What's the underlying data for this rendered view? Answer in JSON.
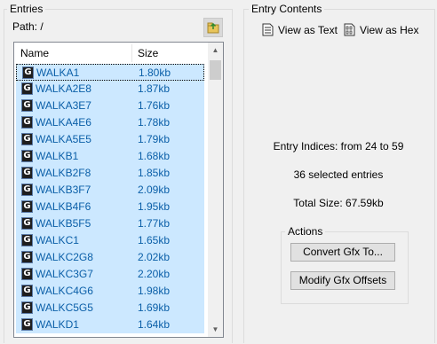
{
  "entries_panel": {
    "title": "Entries",
    "path_label": "Path: /",
    "columns": {
      "name": "Name",
      "size": "Size"
    },
    "entries": [
      {
        "name": "WALKA1",
        "size": "1.80kb"
      },
      {
        "name": "WALKA2E8",
        "size": "1.87kb"
      },
      {
        "name": "WALKA3E7",
        "size": "1.76kb"
      },
      {
        "name": "WALKA4E6",
        "size": "1.78kb"
      },
      {
        "name": "WALKA5E5",
        "size": "1.79kb"
      },
      {
        "name": "WALKB1",
        "size": "1.68kb"
      },
      {
        "name": "WALKB2F8",
        "size": "1.85kb"
      },
      {
        "name": "WALKB3F7",
        "size": "2.09kb"
      },
      {
        "name": "WALKB4F6",
        "size": "1.95kb"
      },
      {
        "name": "WALKB5F5",
        "size": "1.77kb"
      },
      {
        "name": "WALKC1",
        "size": "1.65kb"
      },
      {
        "name": "WALKC2G8",
        "size": "2.02kb"
      },
      {
        "name": "WALKC3G7",
        "size": "2.20kb"
      },
      {
        "name": "WALKC4G6",
        "size": "1.98kb"
      },
      {
        "name": "WALKC5G5",
        "size": "1.69kb"
      },
      {
        "name": "WALKD1",
        "size": "1.64kb"
      }
    ],
    "entry_type_glyph": "G"
  },
  "contents_panel": {
    "title": "Entry Contents",
    "view_as_text": "View as Text",
    "view_as_hex": "View as Hex",
    "entry_indices": "Entry Indices: from 24 to 59",
    "selected_count": "36 selected entries",
    "total_size": "Total Size: 67.59kb",
    "actions": {
      "title": "Actions",
      "convert_gfx": "Convert Gfx To...",
      "modify_gfx_offsets": "Modify Gfx Offsets"
    }
  },
  "colors": {
    "selection": "#cce8ff",
    "selected_text": "#0b5fa8",
    "window_bg": "#f0f0f0"
  },
  "icons": {
    "open_folder": "open-folder-icon",
    "view_text": "text-document-icon",
    "view_hex": "hex-document-icon",
    "entry_type": "graphic-entry-icon"
  }
}
